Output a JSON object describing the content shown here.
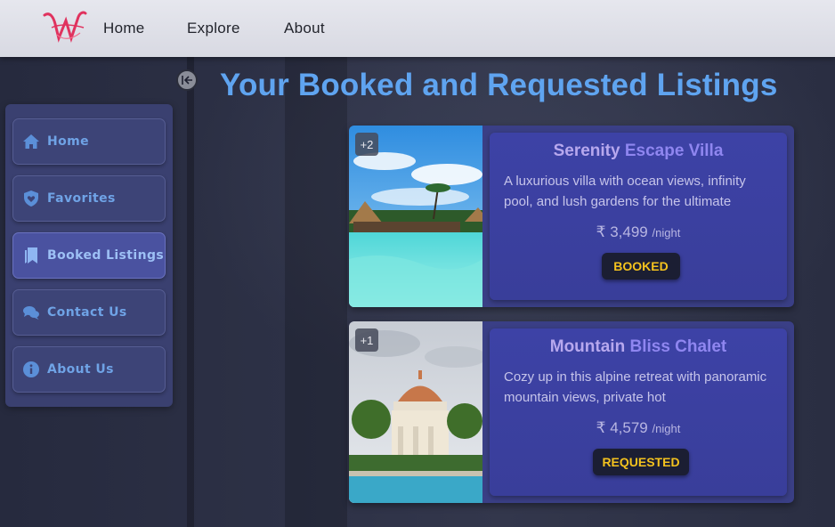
{
  "topbar": {
    "nav": [
      "Home",
      "Explore",
      "About"
    ]
  },
  "page": {
    "title": "Your Booked and Requested Listings"
  },
  "sidebar": {
    "items": [
      {
        "label": "Home",
        "icon": "home-icon"
      },
      {
        "label": "Favorites",
        "icon": "shield-heart-icon"
      },
      {
        "label": "Booked Listings",
        "icon": "bookmark-icon",
        "active": true
      },
      {
        "label": "Contact Us",
        "icon": "chat-icon"
      },
      {
        "label": "About Us",
        "icon": "info-icon"
      }
    ]
  },
  "listings": [
    {
      "extra_photos": "+2",
      "name_first": "Serenity",
      "name_rest": "Escape Villa",
      "description": "A luxurious villa with ocean views, infinity pool, and lush gardens for the ultimate",
      "price": "₹ 3,499",
      "unit": "/night",
      "status": "BOOKED"
    },
    {
      "extra_photos": "+1",
      "name_first": "Mountain",
      "name_rest": "Bliss Chalet",
      "description": "Cozy up in this alpine retreat with panoramic mountain views, private hot",
      "price": "₹ 4,579",
      "unit": "/night",
      "status": "REQUESTED"
    }
  ],
  "colors": {
    "title": "#5fa4f0",
    "status_text": "#f4c21e",
    "card": "#3a3f86"
  }
}
